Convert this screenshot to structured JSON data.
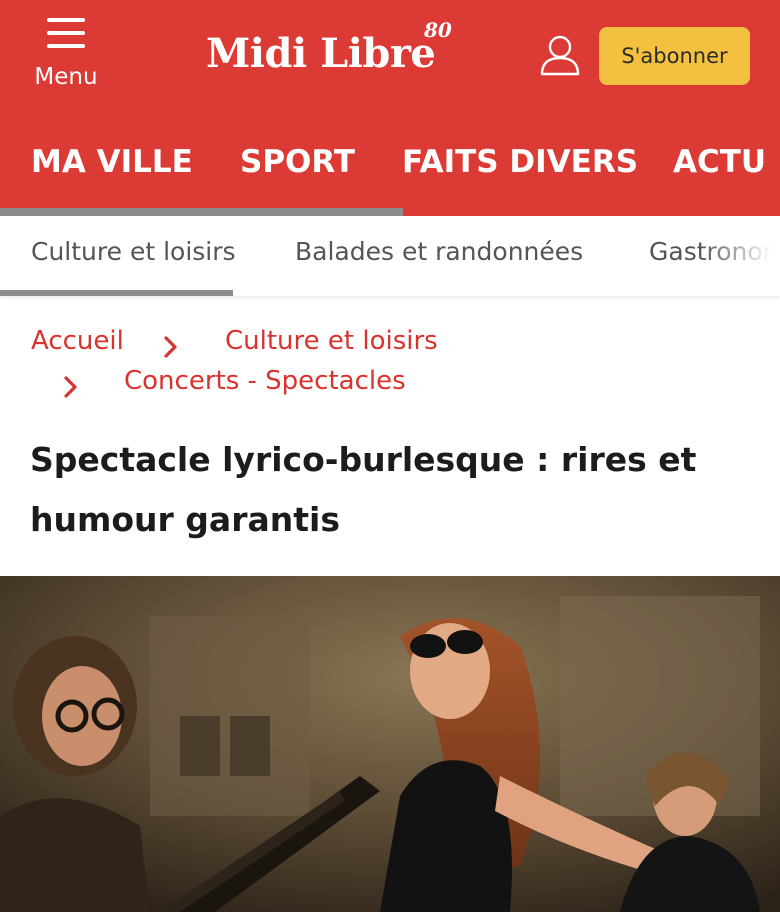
{
  "header": {
    "menu_label": "Menu",
    "logo_text": "Midi Libre",
    "logo_badge": "80",
    "subscribe_label": "S'abonner",
    "brand_color": "#dc3a34",
    "subscribe_color": "#f3c03f"
  },
  "main_nav": {
    "items": [
      {
        "label": "MA VILLE"
      },
      {
        "label": "SPORT"
      },
      {
        "label": "FAITS DIVERS"
      },
      {
        "label": "ACTU"
      }
    ],
    "active_index": 0
  },
  "sub_nav": {
    "items": [
      {
        "label": "Culture et loisirs"
      },
      {
        "label": "Balades et randonnées"
      },
      {
        "label": "Gastronomie"
      }
    ],
    "active_index": 0
  },
  "breadcrumb": {
    "items": [
      {
        "label": "Accueil"
      },
      {
        "label": "Culture et loisirs"
      },
      {
        "label": "Concerts - Spectacles"
      }
    ],
    "link_color": "#d8332f"
  },
  "article": {
    "title": "Spectacle lyrico-burlesque : rires et humour garantis"
  },
  "icons": {
    "menu": "hamburger-icon",
    "account": "user-icon",
    "separator": "chevron-right-icon"
  }
}
